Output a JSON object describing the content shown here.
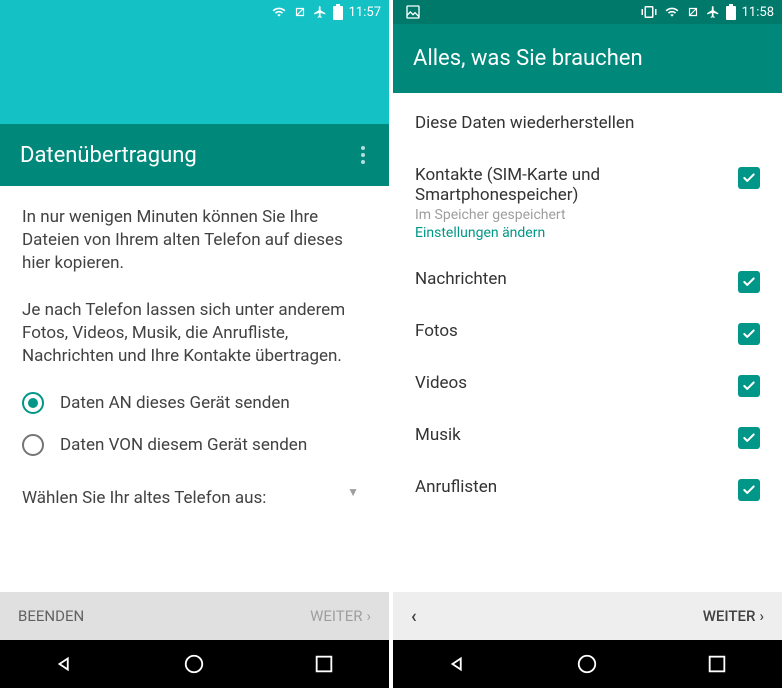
{
  "phone1": {
    "status_time": "11:57",
    "title": "Datenübertragung",
    "para1": "In nur wenigen Minuten können Sie Ihre Dateien von Ihrem alten Telefon auf dieses hier kopieren.",
    "para2": "Je nach Telefon lassen sich unter anderem Fotos, Videos, Musik, die Anrufliste, Nachrichten und Ihre Kontakte übertragen.",
    "radio1_label": "Daten AN dieses Gerät senden",
    "radio2_label": "Daten VON diesem Gerät senden",
    "select_label": "Wählen Sie Ihr altes Telefon aus:",
    "btn_left": "BEENDEN",
    "btn_right": "WEITER"
  },
  "phone2": {
    "status_time": "11:58",
    "title": "Alles, was Sie brauchen",
    "restore_heading": "Diese Daten wiederherstellen",
    "items": [
      {
        "label": "Kontakte (SIM-Karte und Smartphonespeicher)",
        "sub": "Im Speicher gespeichert",
        "link": "Einstellungen ändern",
        "checked": true
      },
      {
        "label": "Nachrichten",
        "checked": true
      },
      {
        "label": "Fotos",
        "checked": true
      },
      {
        "label": "Videos",
        "checked": true
      },
      {
        "label": "Musik",
        "checked": true
      },
      {
        "label": "Anruflisten",
        "checked": true
      }
    ],
    "btn_right": "WEITER"
  }
}
